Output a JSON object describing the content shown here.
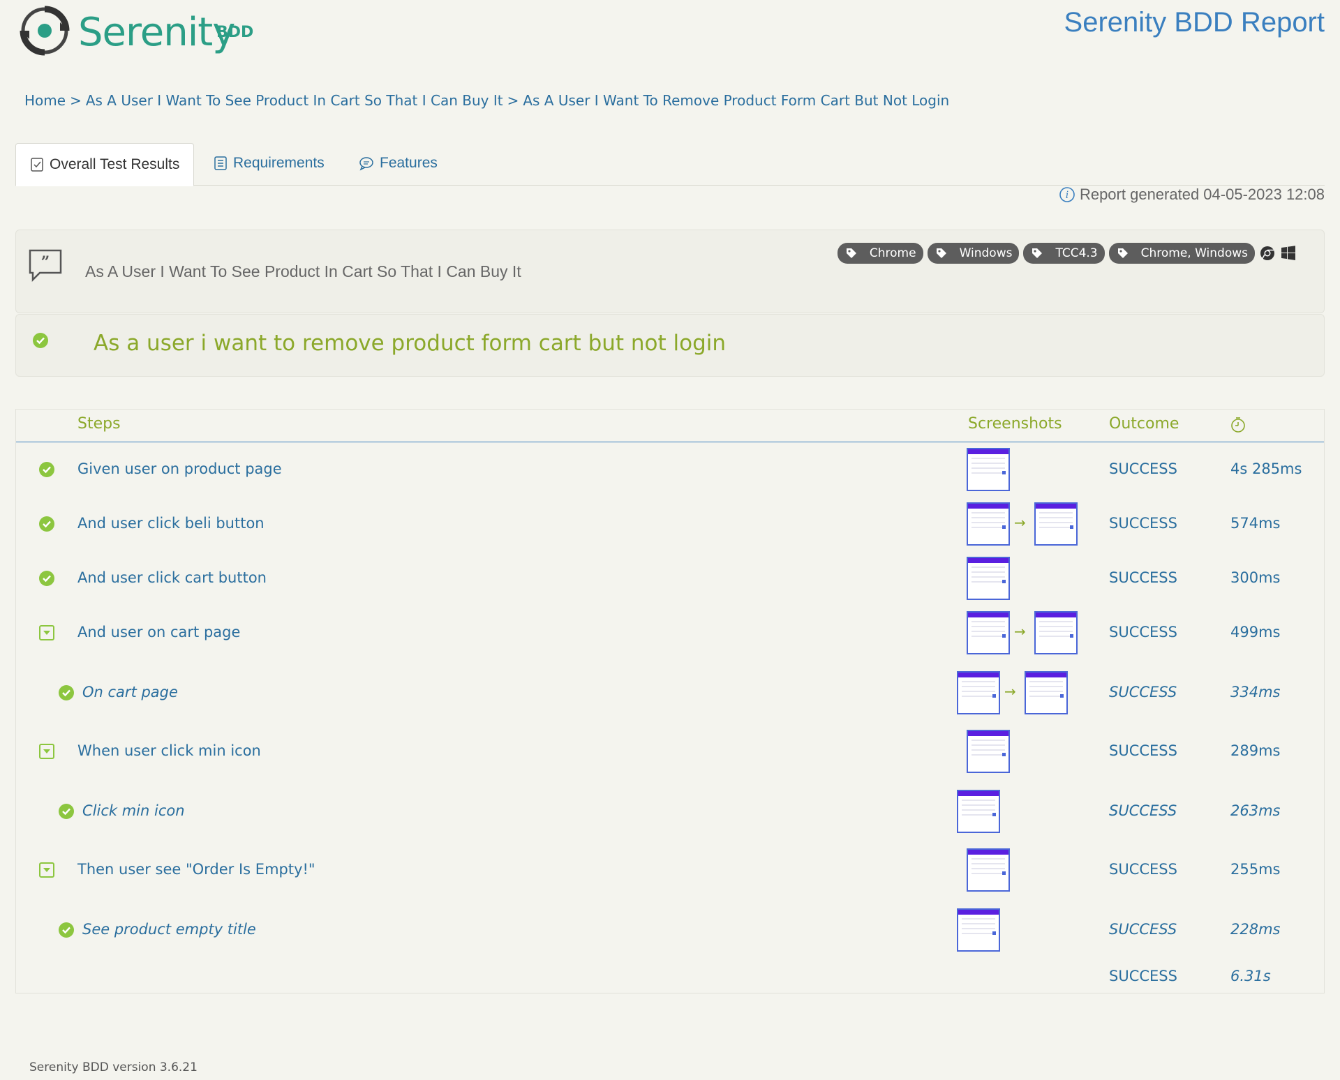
{
  "header": {
    "logo_text": "Serenity",
    "logo_suffix": "BDD",
    "report_title": "Serenity BDD Report"
  },
  "breadcrumb": {
    "items": [
      "Home",
      "As A User I Want To See Product In Cart So That I Can Buy It",
      "As A User I Want To Remove Product Form Cart But Not Login"
    ],
    "separator": ">"
  },
  "tabs": [
    {
      "label": "Overall Test Results",
      "icon": "checklist-icon",
      "active": true
    },
    {
      "label": "Requirements",
      "icon": "document-icon",
      "active": false
    },
    {
      "label": "Features",
      "icon": "speech-bubble-icon",
      "active": false
    }
  ],
  "report_generated": "Report generated 04-05-2023 12:08",
  "requirement": {
    "title": "As A User I Want To See Product In Cart So That I Can Buy It",
    "tags": [
      "Chrome",
      "Windows",
      "TCC4.3",
      "Chrome, Windows"
    ],
    "platform_icons": [
      "chrome-icon",
      "windows-icon"
    ]
  },
  "scenario": {
    "title": "As a user i want to remove product form cart but not login",
    "status_icon": "success-check-icon"
  },
  "steps_table": {
    "headers": {
      "steps": "Steps",
      "screenshots": "Screenshots",
      "outcome": "Outcome",
      "duration_icon": "stopwatch-icon"
    },
    "rows": [
      {
        "text": "Given user on product page",
        "outcome": "SUCCESS",
        "duration": "4s 285ms",
        "icon": "success-check-icon",
        "sub": false,
        "screenshots": 1
      },
      {
        "text": "And user click beli button",
        "outcome": "SUCCESS",
        "duration": "574ms",
        "icon": "success-check-icon",
        "sub": false,
        "screenshots": 2
      },
      {
        "text": "And user click cart button",
        "outcome": "SUCCESS",
        "duration": "300ms",
        "icon": "success-check-icon",
        "sub": false,
        "screenshots": 1
      },
      {
        "text": "And user on cart page",
        "outcome": "SUCCESS",
        "duration": "499ms",
        "icon": "expand-toggle-icon",
        "sub": false,
        "screenshots": 2
      },
      {
        "text": "On cart page",
        "outcome": "SUCCESS",
        "duration": "334ms",
        "icon": "success-check-icon",
        "sub": true,
        "screenshots": 2
      },
      {
        "text": "When user click min icon",
        "outcome": "SUCCESS",
        "duration": "289ms",
        "icon": "expand-toggle-icon",
        "sub": false,
        "screenshots": 1
      },
      {
        "text": "Click min icon",
        "outcome": "SUCCESS",
        "duration": "263ms",
        "icon": "success-check-icon",
        "sub": true,
        "screenshots": 1
      },
      {
        "text": "Then user see \"Order Is Empty!\"",
        "outcome": "SUCCESS",
        "duration": "255ms",
        "icon": "expand-toggle-icon",
        "sub": false,
        "screenshots": 1
      },
      {
        "text": "See product empty title",
        "outcome": "SUCCESS",
        "duration": "228ms",
        "icon": "success-check-icon",
        "sub": true,
        "screenshots": 1
      }
    ],
    "total": {
      "outcome": "SUCCESS",
      "duration": "6.31s"
    }
  },
  "footer": {
    "version": "Serenity BDD version 3.6.21"
  },
  "colors": {
    "background": "#f4f4ee",
    "accent_green": "#8ba82a",
    "link_blue": "#2a6e9e",
    "title_blue": "#3a7fbf",
    "brand_teal": "#2b9e86",
    "tag_gray": "#5d5d5d"
  }
}
